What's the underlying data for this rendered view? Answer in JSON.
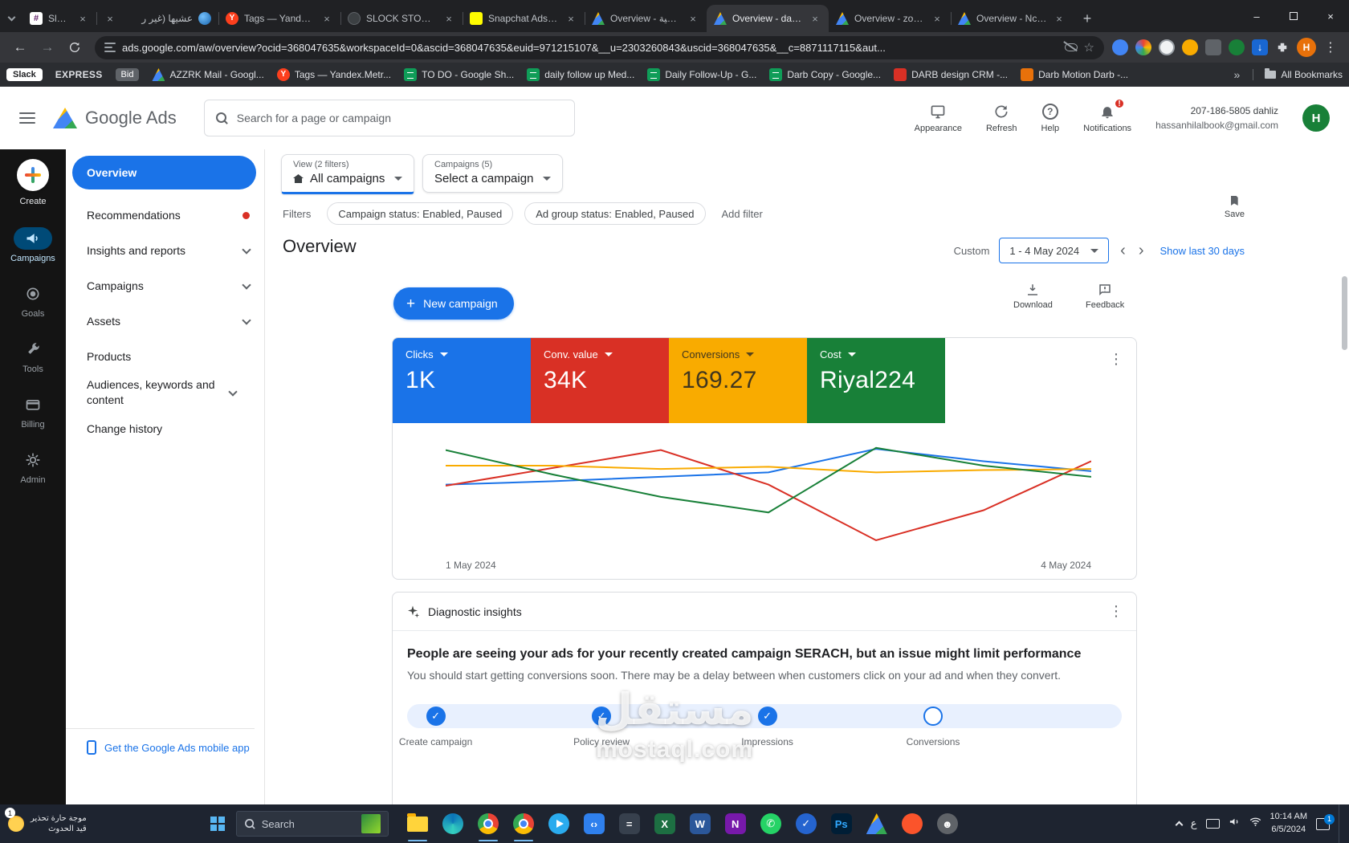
{
  "browser": {
    "tabs": [
      {
        "title": "Slack"
      },
      {
        "title": "عشيها (غير ر"
      },
      {
        "title": "Tags — Yandex.Me..."
      },
      {
        "title": "SLOCK STORE — C..."
      },
      {
        "title": "Snapchat Ads Man..."
      },
      {
        "title": "Overview - الذكية..."
      },
      {
        "title": "Overview - dahliz"
      },
      {
        "title": "Overview - zoba -"
      },
      {
        "title": "Overview - Ncomf..."
      }
    ],
    "url": "ads.google.com/aw/overview?ocid=368047635&workspaceId=0&ascid=368047635&euid=971215107&__u=2303260843&uscid=368047635&__c=8871117115&aut...",
    "bookmarks": [
      "Slack",
      "EXPRESS",
      "Bid",
      "AZZRK Mail - Googl...",
      "Tags — Yandex.Metr...",
      "TO DO - Google Sh...",
      "daily follow up Med...",
      "Daily Follow-Up - G...",
      "Darb Copy - Google...",
      "DARB design CRM -...",
      "Darb Motion Darb -..."
    ],
    "all_bookmarks": "All Bookmarks"
  },
  "ads_header": {
    "product": "Google Ads",
    "search_placeholder": "Search for a page or campaign",
    "appearance": "Appearance",
    "refresh": "Refresh",
    "help": "Help",
    "notifications": "Notifications",
    "phone": "207-186-5805 dahliz",
    "email": "hassanhilalbook@gmail.com",
    "avatar": "H"
  },
  "rail": {
    "items": [
      {
        "label": "Create"
      },
      {
        "label": "Campaigns"
      },
      {
        "label": "Goals"
      },
      {
        "label": "Tools"
      },
      {
        "label": "Billing"
      },
      {
        "label": "Admin"
      }
    ]
  },
  "sidebar": {
    "items": [
      {
        "label": "Overview"
      },
      {
        "label": "Recommendations"
      },
      {
        "label": "Insights and reports"
      },
      {
        "label": "Campaigns"
      },
      {
        "label": "Assets"
      },
      {
        "label": "Products"
      },
      {
        "label": "Audiences, keywords and content"
      },
      {
        "label": "Change history"
      }
    ],
    "mobile_app": "Get the Google Ads mobile app"
  },
  "selectors": {
    "view_label": "View (2 filters)",
    "view_value": "All campaigns",
    "campaign_label": "Campaigns (5)",
    "campaign_value": "Select a campaign"
  },
  "filters": {
    "label": "Filters",
    "chips": [
      "Campaign status: Enabled, Paused",
      "Ad group status: Enabled, Paused"
    ],
    "add_filter": "Add filter",
    "save": "Save"
  },
  "overview": {
    "title": "Overview",
    "custom": "Custom",
    "date_range": "1 - 4 May 2024",
    "show_last_30": "Show last 30 days",
    "new_campaign": "New campaign",
    "download": "Download",
    "feedback": "Feedback"
  },
  "metrics": [
    {
      "label": "Clicks",
      "value": "1K",
      "color": "#1a73e8"
    },
    {
      "label": "Conv. value",
      "value": "34K",
      "color": "#d93025"
    },
    {
      "label": "Conversions",
      "value": "169.27",
      "color": "#f9ab00"
    },
    {
      "label": "Cost",
      "value": "Riyal224",
      "color": "#188038"
    }
  ],
  "chart_data": {
    "type": "line",
    "x_labels": [
      "1 May 2024",
      "4 May 2024"
    ],
    "legend": "none (colors match metric cards)",
    "y_axis": "unlabeled, values normalized 0-100",
    "series": [
      {
        "name": "Clicks",
        "color": "#1a73e8",
        "values": [
          63,
          66,
          70,
          74,
          95,
          84,
          75
        ]
      },
      {
        "name": "Conv. value",
        "color": "#d93025",
        "values": [
          62,
          78,
          94,
          63,
          13,
          40,
          84
        ]
      },
      {
        "name": "Conversions",
        "color": "#f9ab00",
        "values": [
          80,
          80,
          77,
          79,
          74,
          76,
          77
        ]
      },
      {
        "name": "Cost",
        "color": "#188038",
        "values": [
          94,
          72,
          52,
          38,
          96,
          80,
          70
        ]
      }
    ]
  },
  "diagnostic": {
    "title": "Diagnostic insights",
    "heading": "People are seeing your ads for your recently created campaign SERACH, but an issue might limit performance",
    "body": "You should start getting conversions soon. There may be a delay between when customers click on your ad and when they convert.",
    "steps": [
      {
        "label": "Create campaign",
        "state": "done"
      },
      {
        "label": "Policy review",
        "state": "done"
      },
      {
        "label": "Impressions",
        "state": "done"
      },
      {
        "label": "Conversions",
        "state": "pending"
      }
    ]
  },
  "taskbar": {
    "widget_line1": "موجة حارة تحذير",
    "widget_line2": "قيد الحدوث",
    "widget_badge": "1",
    "search_placeholder": "Search",
    "lang": "ع",
    "time": "10:14 AM",
    "date": "6/5/2024"
  },
  "watermark": {
    "line1": "مستقل",
    "line2": "mostaql.com"
  }
}
